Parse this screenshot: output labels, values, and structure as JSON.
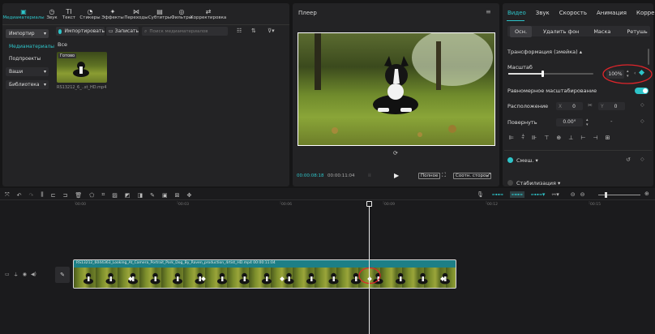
{
  "toolbar": {
    "items": [
      {
        "label": "Медиаматериалы",
        "icon": "media-icon"
      },
      {
        "label": "Звук",
        "icon": "audio-icon"
      },
      {
        "label": "Текст",
        "icon": "text-icon"
      },
      {
        "label": "Стикеры",
        "icon": "sticker-icon"
      },
      {
        "label": "Эффекты",
        "icon": "effects-icon"
      },
      {
        "label": "Переходы",
        "icon": "transitions-icon"
      },
      {
        "label": "Субтитры",
        "icon": "subtitles-icon"
      },
      {
        "label": "Фильтры",
        "icon": "filters-icon"
      },
      {
        "label": "Корректировка",
        "icon": "adjust-icon"
      }
    ]
  },
  "media_sidebar": {
    "items": [
      "Импортир",
      "Медиаматериалы",
      "Подпроекты",
      "Ваши",
      "Библиотека"
    ]
  },
  "media": {
    "import_label": "Импортировать",
    "record_label": "Записать",
    "search_placeholder": "Поиск медиаматериалов",
    "section_label": "Все",
    "clip": {
      "badge": "Готово",
      "filename": "RS13212_6_..st_HD.mp4"
    }
  },
  "player": {
    "title": "Плеер",
    "time_current": "00:00:08:18",
    "time_total": "00:00:11:04",
    "full_label": "Полное",
    "ratio_label": "Соотн. сторон"
  },
  "inspector": {
    "tabs": [
      "Видео",
      "Звук",
      "Скорость",
      "Анимация",
      "Корре"
    ],
    "subtabs": [
      "Осн.",
      "Удалить фон",
      "Маска",
      "Ретушь"
    ],
    "section_title": "Трансформация (змейка)",
    "scale_label": "Масштаб",
    "scale_value": "100%",
    "scale_level": 0.4,
    "uniform_label": "Равномерное масштабирование",
    "position_label": "Расположение",
    "pos_x_label": "X",
    "pos_x": "0",
    "pos_y_label": "Y",
    "pos_y": "0",
    "rotate_label": "Повернуть",
    "rotate_value": "0.00°",
    "rotate_dash": "-",
    "blend_label": "Смеш.",
    "stabilize_label": "Стабилизация"
  },
  "timeline": {
    "ruler": [
      "00:00",
      "00:03",
      "00:06",
      "00:09",
      "00:12",
      "00:15"
    ],
    "clip_label": "RS13212_6044363_Looking_At_Camera_Portrait_Park_Dog_By_Raven_production_4rtist_HD.mp4   00:00:11:04"
  },
  "colors": {
    "accent": "#2ec4c9",
    "annotation": "#e0252b",
    "clip": "#1d7f86"
  }
}
